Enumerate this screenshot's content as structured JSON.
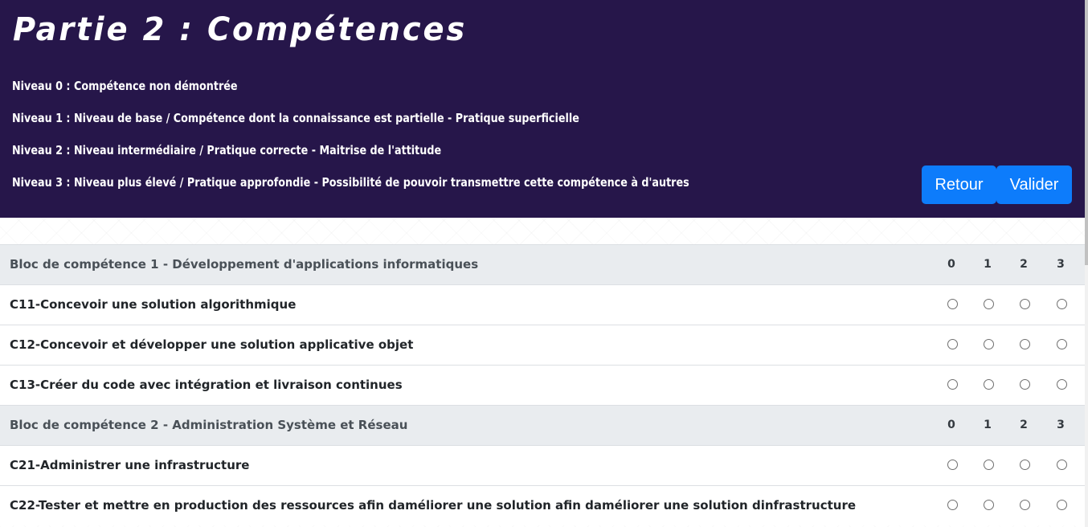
{
  "header": {
    "title": "Partie 2 : Compétences",
    "levels": [
      "Niveau 0 : Compétence non démontrée",
      "Niveau 1 : Niveau de base / Compétence dont la connaissance est partielle - Pratique superficielle",
      "Niveau 2 : Niveau intermédiaire / Pratique correcte - Maitrise de l'attitude",
      "Niveau 3 : Niveau plus élevé / Pratique approfondie - Possibilité de pouvoir transmettre cette compétence à d'autres"
    ],
    "retour_label": "Retour",
    "valider_label": "Valider"
  },
  "colors": {
    "header_bg": "#26164a",
    "button_bg": "#0d7cfb",
    "block_row_bg": "#e9ecef"
  },
  "blocks": [
    {
      "title": "Bloc de compétence 1 - Développement d'applications informatiques",
      "levels": [
        "0",
        "1",
        "2",
        "3"
      ],
      "competences": [
        {
          "label": "C11-Concevoir une solution algorithmique"
        },
        {
          "label": "C12-Concevoir et développer une solution applicative objet"
        },
        {
          "label": "C13-Créer du code avec intégration et livraison continues"
        }
      ]
    },
    {
      "title": "Bloc de compétence 2 - Administration Système et Réseau",
      "levels": [
        "0",
        "1",
        "2",
        "3"
      ],
      "competences": [
        {
          "label": "C21-Administrer une infrastructure"
        },
        {
          "label": "C22-Tester et mettre en production des ressources afin daméliorer une solution afin daméliorer une solution dinfrastructure"
        }
      ]
    }
  ]
}
